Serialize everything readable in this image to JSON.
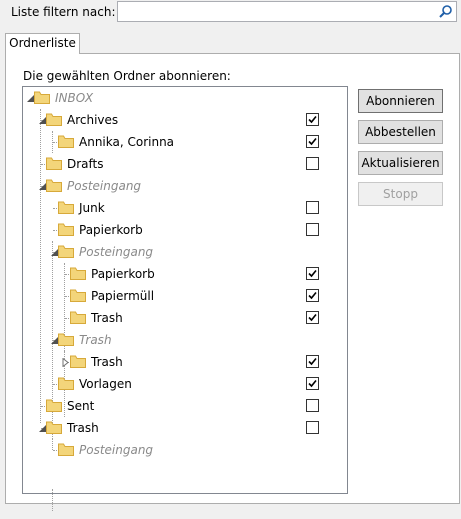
{
  "filter": {
    "label": "Liste filtern nach:",
    "value": "",
    "placeholder": ""
  },
  "tab": {
    "label": "Ordnerliste"
  },
  "panel": {
    "heading": "Die gewählten Ordner abonnieren:"
  },
  "tree": {
    "rows": [
      {
        "label": "INBOX",
        "gray": true,
        "checkbox": false,
        "checked": false
      },
      {
        "label": "Archives",
        "gray": false,
        "checkbox": true,
        "checked": true
      },
      {
        "label": "Annika, Corinna",
        "gray": false,
        "checkbox": true,
        "checked": true
      },
      {
        "label": "Drafts",
        "gray": false,
        "checkbox": true,
        "checked": false
      },
      {
        "label": "Posteingang",
        "gray": true,
        "checkbox": false,
        "checked": false
      },
      {
        "label": "Junk",
        "gray": false,
        "checkbox": true,
        "checked": false
      },
      {
        "label": "Papierkorb",
        "gray": false,
        "checkbox": true,
        "checked": false
      },
      {
        "label": "Posteingang",
        "gray": true,
        "checkbox": false,
        "checked": false
      },
      {
        "label": "Papierkorb",
        "gray": false,
        "checkbox": true,
        "checked": true
      },
      {
        "label": "Papiermüll",
        "gray": false,
        "checkbox": true,
        "checked": true
      },
      {
        "label": "Trash",
        "gray": false,
        "checkbox": true,
        "checked": true
      },
      {
        "label": "Trash",
        "gray": true,
        "checkbox": false,
        "checked": false
      },
      {
        "label": "Trash",
        "gray": false,
        "checkbox": true,
        "checked": true,
        "collapsed": true
      },
      {
        "label": "Vorlagen",
        "gray": false,
        "checkbox": true,
        "checked": true
      },
      {
        "label": "Sent",
        "gray": false,
        "checkbox": true,
        "checked": false
      },
      {
        "label": "Trash",
        "gray": false,
        "checkbox": true,
        "checked": false
      },
      {
        "label": "Posteingang",
        "gray": true,
        "checkbox": false,
        "checked": false
      }
    ]
  },
  "buttons": {
    "subscribe": "Abonnieren",
    "unsubscribe": "Abbestellen",
    "refresh": "Aktualisieren",
    "stop": "Stopp"
  },
  "colors": {
    "folder_fill": "#f3d57a",
    "folder_edge": "#d7a93a",
    "panel_border": "#adadad"
  }
}
